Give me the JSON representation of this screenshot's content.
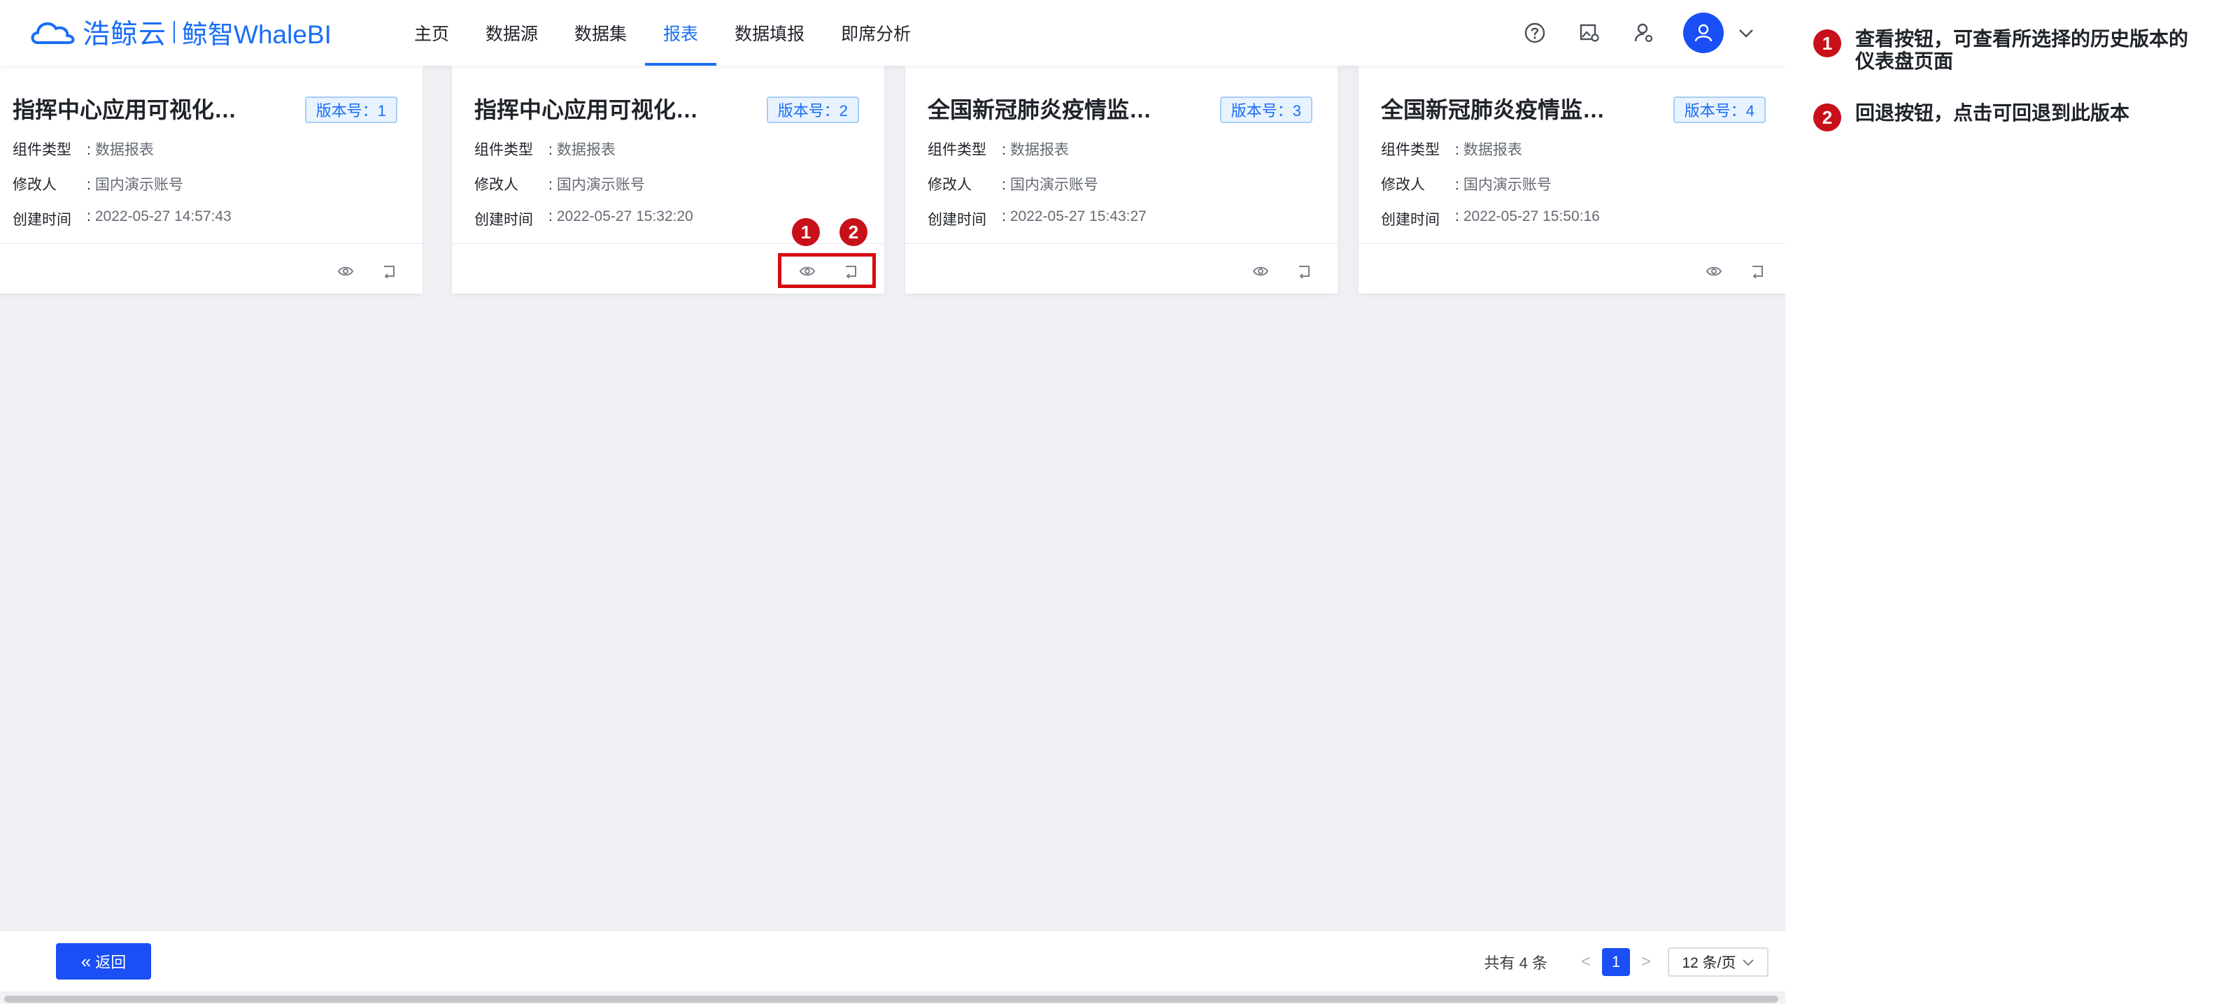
{
  "header": {
    "logo_main": "浩鲸云",
    "logo_sub": "鲸智WhaleBI",
    "nav": [
      {
        "label": "主页"
      },
      {
        "label": "数据源"
      },
      {
        "label": "数据集"
      },
      {
        "label": "报表",
        "active": true
      },
      {
        "label": "数据填报"
      },
      {
        "label": "即席分析"
      }
    ],
    "icons": [
      "help-icon",
      "image-settings-icon",
      "user-settings-icon",
      "avatar",
      "chevron-down-icon"
    ]
  },
  "labels": {
    "type": "组件类型",
    "modifier": "修改人",
    "created": "创建时间"
  },
  "cards": [
    {
      "title": "指挥中心应用可视化…",
      "badge": "版本号：1",
      "type": "数据报表",
      "modifier": "国内演示账号",
      "created": "2022-05-27 14:57:43"
    },
    {
      "title": "指挥中心应用可视化…",
      "badge": "版本号：2",
      "type": "数据报表",
      "modifier": "国内演示账号",
      "created": "2022-05-27 15:32:20"
    },
    {
      "title": "全国新冠肺炎疫情监…",
      "badge": "版本号：3",
      "type": "数据报表",
      "modifier": "国内演示账号",
      "created": "2022-05-27 15:43:27"
    },
    {
      "title": "全国新冠肺炎疫情监…",
      "badge": "版本号：4",
      "type": "数据报表",
      "modifier": "国内演示账号",
      "created": "2022-05-27 15:50:16"
    }
  ],
  "footer": {
    "back_label": "返回",
    "back_icon": "«",
    "total": "共有 4 条",
    "prev": "<",
    "page": "1",
    "next": ">",
    "page_size": "12 条/页"
  },
  "annotations": {
    "markers": [
      "1",
      "2"
    ],
    "notes": [
      {
        "num": "1",
        "text": "查看按钮，可查看所选择的历史版本的仪表盘页面"
      },
      {
        "num": "2",
        "text": "回退按钮，点击可回退到此版本"
      }
    ],
    "highlight_color": "#d40d12"
  },
  "colors": {
    "primary": "#1a4ff5",
    "brand": "#1a6ef5",
    "marker": "#c8101a"
  }
}
